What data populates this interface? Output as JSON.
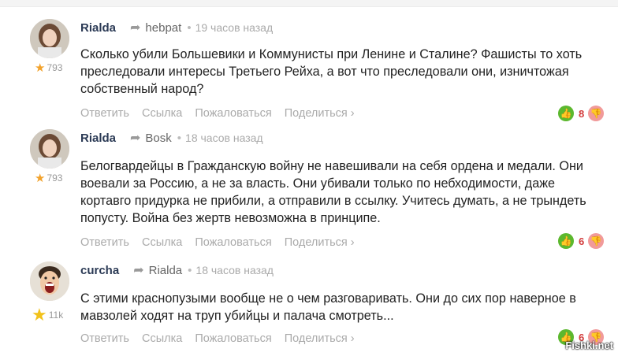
{
  "comments": [
    {
      "author": "Rialda",
      "reply_to": "hebpat",
      "time": "19 часов назад",
      "rating": "793",
      "text": "Сколько убили Большевики и Коммунисты при Ленине и Сталине? Фашисты то хоть преследовали интересы Третьего Рейха, а вот что преследовали они, изничтожая собственный народ?",
      "votes": "8",
      "avatar": "woman-portrait"
    },
    {
      "author": "Rialda",
      "reply_to": "Bosk",
      "time": "18 часов назад",
      "rating": "793",
      "text": "Белогвардейцы в Гражданскую войну не навешивали на себя ордена и медали. Они воевали за Россию, а не за власть. Они убивали только по небходимости, даже кортавго придурка не прибили, а отправили в ссылку. Учитесь думать, а не трындеть попусту. Война без жертв невозможна в принципе.",
      "votes": "6",
      "avatar": "woman-portrait"
    },
    {
      "author": "curcha",
      "reply_to": "Rialda",
      "time": "18 часов назад",
      "rating": "11k",
      "text": "С этими краснопузыми вообще не о чем разговаривать. Они до сих пор наверное в мавзолей ходят на труп убийцы и палача смотреть...",
      "votes": "6",
      "avatar": "screaming-man"
    }
  ],
  "actions": {
    "reply": "Ответить",
    "link": "Ссылка",
    "report": "Пожаловаться",
    "share": "Поделиться ›"
  },
  "watermark": "Fishki.net",
  "colors": {
    "author": "#2b3a55",
    "upvote": "#5cb82e",
    "downvote": "#f19a9a",
    "count": "#d23a3a"
  }
}
